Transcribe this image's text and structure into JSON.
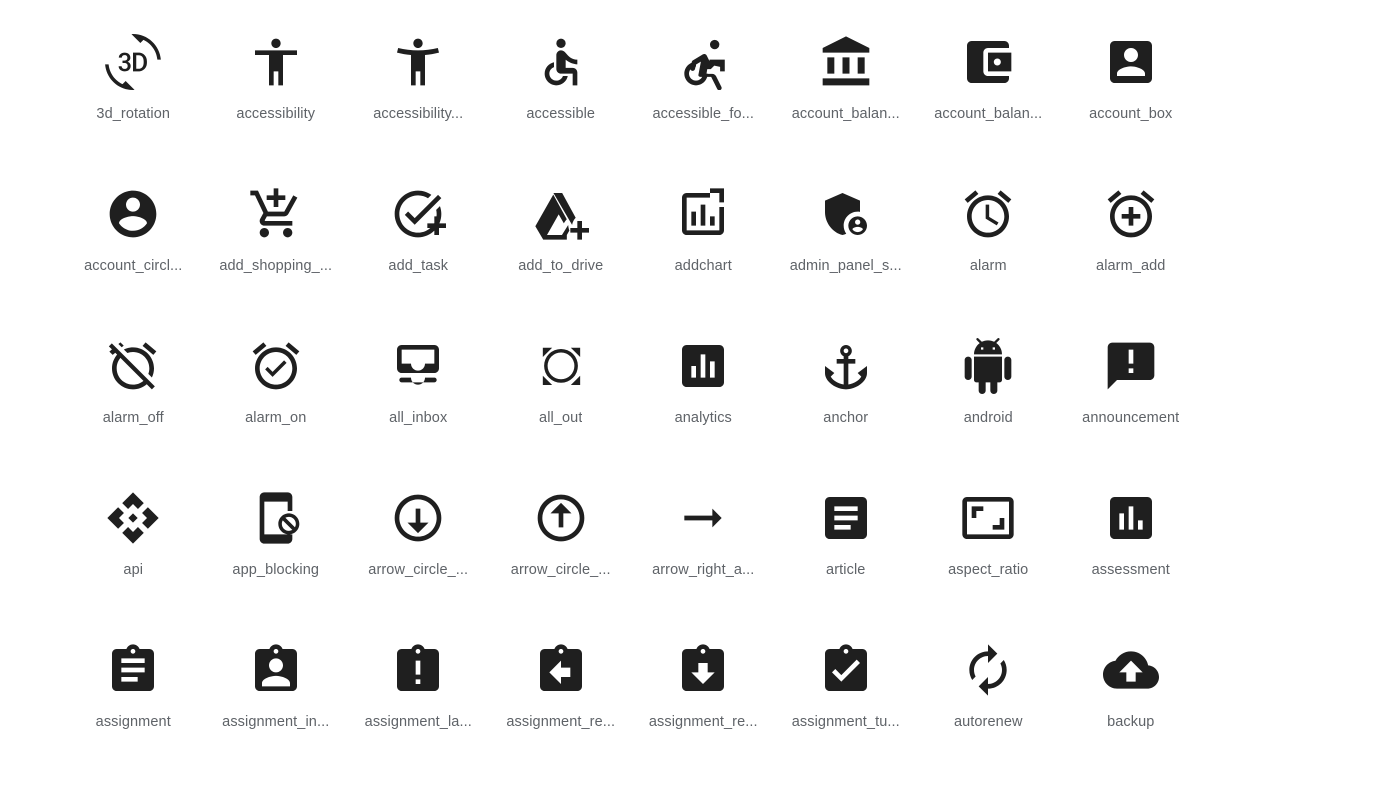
{
  "page": {
    "background_color": "#ffffff",
    "icon_color": "#1f1f1f",
    "label_color": "#5f6368",
    "columns": 8,
    "rows": 5,
    "total_icons": 40
  },
  "icons": [
    {
      "label": "3d_rotation",
      "name": "3d-rotation-icon",
      "glyph": "3d_rotation"
    },
    {
      "label": "accessibility",
      "name": "accessibility-icon",
      "glyph": "accessibility"
    },
    {
      "label": "accessibility...",
      "name": "accessibility-new-icon",
      "glyph": "accessibility_new"
    },
    {
      "label": "accessible",
      "name": "accessible-icon",
      "glyph": "accessible"
    },
    {
      "label": "accessible_fo...",
      "name": "accessible-forward-icon",
      "glyph": "accessible_forward"
    },
    {
      "label": "account_balan...",
      "name": "account-balance-icon",
      "glyph": "account_balance"
    },
    {
      "label": "account_balan...",
      "name": "account-balance-wallet-icon",
      "glyph": "account_balance_wallet"
    },
    {
      "label": "account_box",
      "name": "account-box-icon",
      "glyph": "account_box"
    },
    {
      "label": "account_circl...",
      "name": "account-circle-icon",
      "glyph": "account_circle"
    },
    {
      "label": "add_shopping_...",
      "name": "add-shopping-cart-icon",
      "glyph": "add_shopping_cart"
    },
    {
      "label": "add_task",
      "name": "add-task-icon",
      "glyph": "add_task"
    },
    {
      "label": "add_to_drive",
      "name": "add-to-drive-icon",
      "glyph": "add_to_drive"
    },
    {
      "label": "addchart",
      "name": "addchart-icon",
      "glyph": "addchart"
    },
    {
      "label": "admin_panel_s...",
      "name": "admin-panel-settings-icon",
      "glyph": "admin_panel_settings"
    },
    {
      "label": "alarm",
      "name": "alarm-icon",
      "glyph": "alarm"
    },
    {
      "label": "alarm_add",
      "name": "alarm-add-icon",
      "glyph": "alarm_add"
    },
    {
      "label": "alarm_off",
      "name": "alarm-off-icon",
      "glyph": "alarm_off"
    },
    {
      "label": "alarm_on",
      "name": "alarm-on-icon",
      "glyph": "alarm_on"
    },
    {
      "label": "all_inbox",
      "name": "all-inbox-icon",
      "glyph": "all_inbox"
    },
    {
      "label": "all_out",
      "name": "all-out-icon",
      "glyph": "all_out"
    },
    {
      "label": "analytics",
      "name": "analytics-icon",
      "glyph": "analytics"
    },
    {
      "label": "anchor",
      "name": "anchor-icon",
      "glyph": "anchor"
    },
    {
      "label": "android",
      "name": "android-icon",
      "glyph": "android"
    },
    {
      "label": "announcement",
      "name": "announcement-icon",
      "glyph": "announcement"
    },
    {
      "label": "api",
      "name": "api-icon",
      "glyph": "api"
    },
    {
      "label": "app_blocking",
      "name": "app-blocking-icon",
      "glyph": "app_blocking"
    },
    {
      "label": "arrow_circle_...",
      "name": "arrow-circle-down-icon",
      "glyph": "arrow_circle_down"
    },
    {
      "label": "arrow_circle_...",
      "name": "arrow-circle-up-icon",
      "glyph": "arrow_circle_up"
    },
    {
      "label": "arrow_right_a...",
      "name": "arrow-right-alt-icon",
      "glyph": "arrow_right_alt"
    },
    {
      "label": "article",
      "name": "article-icon",
      "glyph": "article"
    },
    {
      "label": "aspect_ratio",
      "name": "aspect-ratio-icon",
      "glyph": "aspect_ratio"
    },
    {
      "label": "assessment",
      "name": "assessment-icon",
      "glyph": "assessment"
    },
    {
      "label": "assignment",
      "name": "assignment-icon",
      "glyph": "assignment"
    },
    {
      "label": "assignment_in...",
      "name": "assignment-ind-icon",
      "glyph": "assignment_ind"
    },
    {
      "label": "assignment_la...",
      "name": "assignment-late-icon",
      "glyph": "assignment_late"
    },
    {
      "label": "assignment_re...",
      "name": "assignment-return-icon",
      "glyph": "assignment_return"
    },
    {
      "label": "assignment_re...",
      "name": "assignment-returned-icon",
      "glyph": "assignment_returned"
    },
    {
      "label": "assignment_tu...",
      "name": "assignment-turned-in-icon",
      "glyph": "assignment_turned_in"
    },
    {
      "label": "autorenew",
      "name": "autorenew-icon",
      "glyph": "autorenew"
    },
    {
      "label": "backup",
      "name": "backup-icon",
      "glyph": "backup"
    }
  ]
}
